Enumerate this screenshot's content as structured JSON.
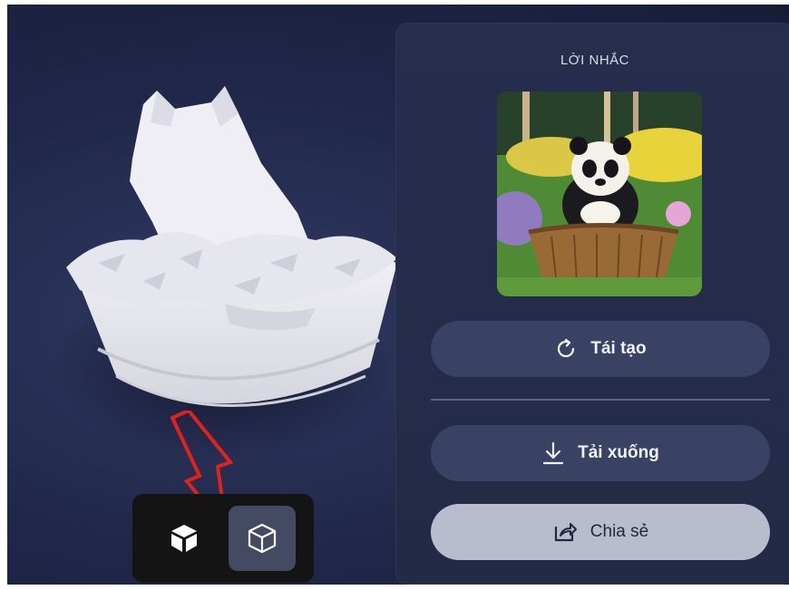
{
  "viewport": {
    "toolbar": {
      "solid_view_icon": "solid-cube-icon",
      "wireframe_view_icon": "wireframe-cube-icon"
    },
    "annotation_color": "#e3211b"
  },
  "panel": {
    "title": "LỜI NHẮC",
    "regenerate": {
      "label": "Tái tạo",
      "icon": "refresh-icon"
    },
    "download": {
      "label": "Tải xuống",
      "icon": "download-icon"
    },
    "share": {
      "label": "Chia sẻ",
      "icon": "share-icon"
    }
  }
}
